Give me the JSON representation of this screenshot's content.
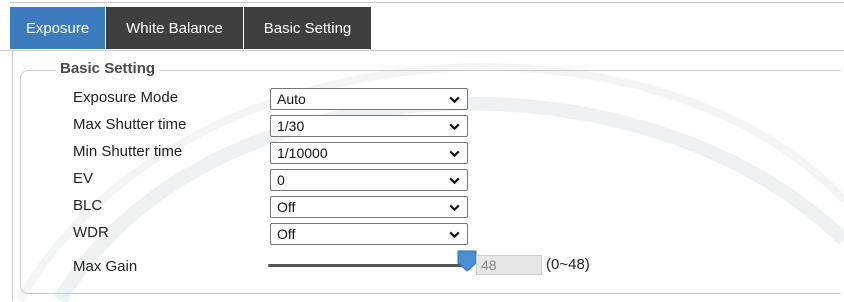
{
  "tabs": [
    {
      "label": "Exposure",
      "active": true
    },
    {
      "label": "White Balance",
      "active": false
    },
    {
      "label": "Basic Setting",
      "active": false
    }
  ],
  "section": {
    "legend": "Basic Setting"
  },
  "fields": [
    {
      "label": "Exposure Mode",
      "value": "Auto"
    },
    {
      "label": "Max Shutter time",
      "value": "1/30"
    },
    {
      "label": "Min Shutter time",
      "value": "1/10000"
    },
    {
      "label": "EV",
      "value": "0"
    },
    {
      "label": "BLC",
      "value": "Off"
    },
    {
      "label": "WDR",
      "value": "Off"
    }
  ],
  "max_gain": {
    "label": "Max Gain",
    "value": "48",
    "range": "(0~48)",
    "slider_fraction": 1.0
  },
  "colors": {
    "tab_active": "#3d7bbf",
    "tab_inactive": "#3f3f3f",
    "slider_handle": "#4a8fd6"
  }
}
